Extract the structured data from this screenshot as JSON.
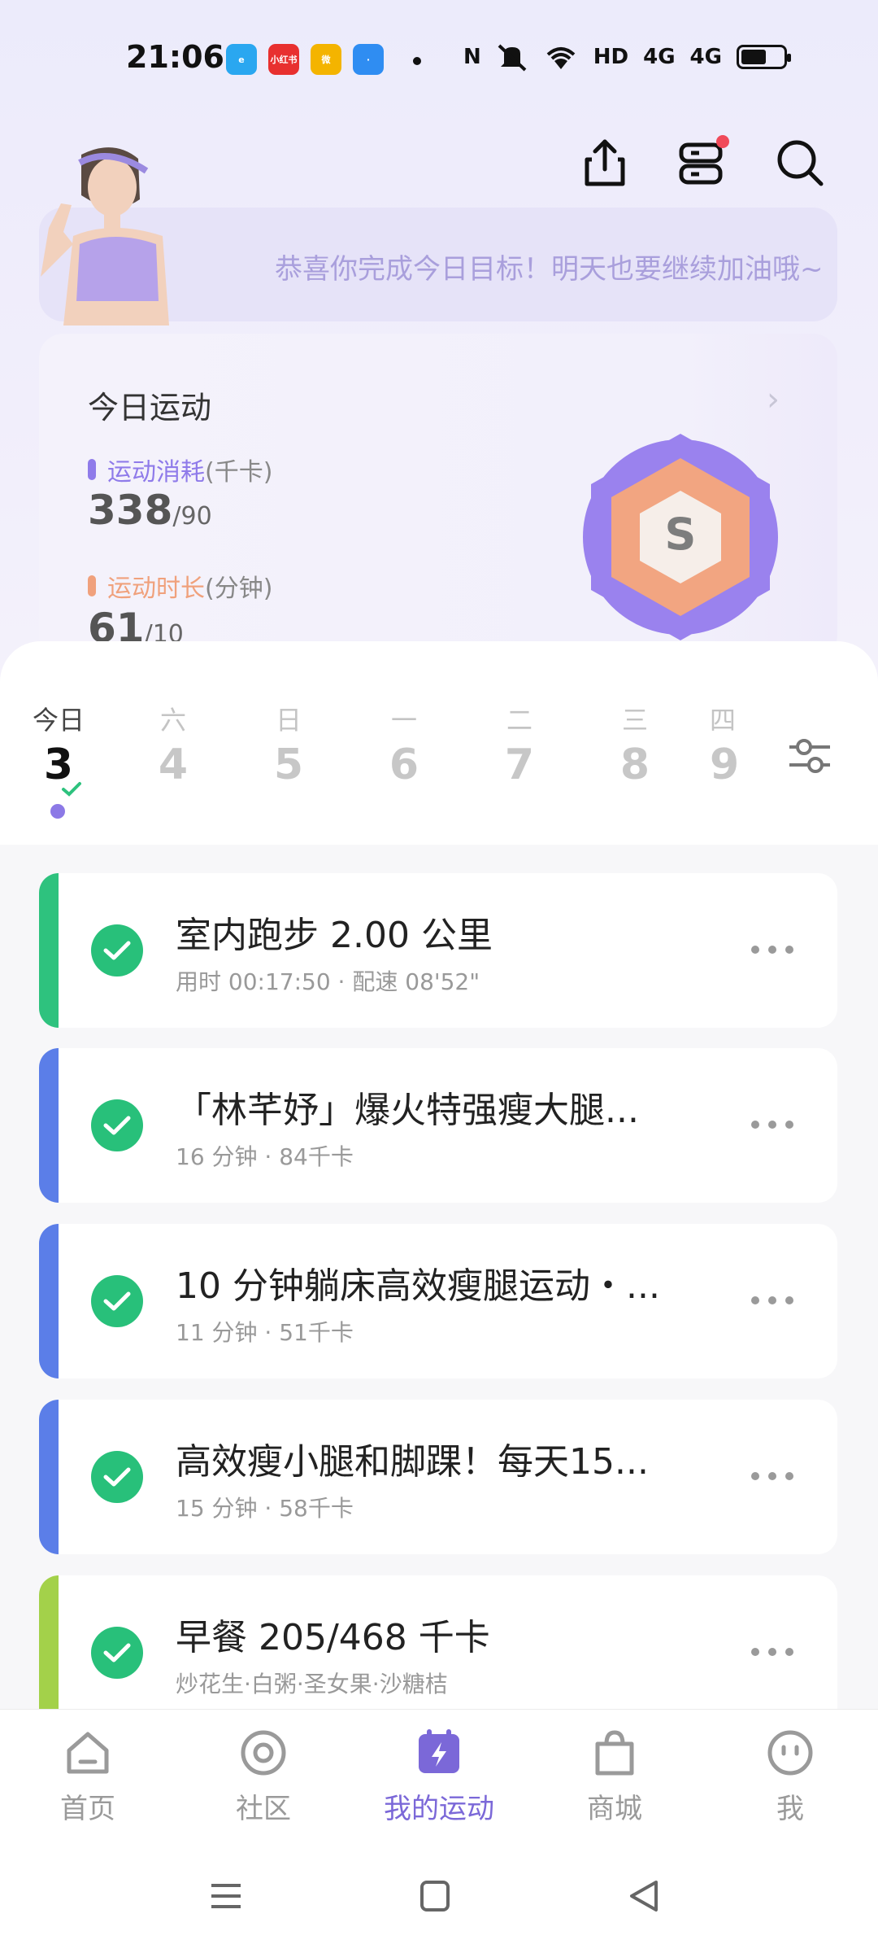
{
  "status_bar": {
    "time": "21:06",
    "notif_labels": [
      "e",
      "小红书",
      "微",
      "·"
    ],
    "net_labels": [
      "N",
      "HD",
      "4G",
      "4G"
    ]
  },
  "header": {
    "share_icon": "share-icon",
    "devices_icon": "devices-icon",
    "search_icon": "search-icon"
  },
  "banner": {
    "message": "恭喜你完成今日目标！明天也要继续加油哦~"
  },
  "today": {
    "title": "今日运动",
    "calories_label": "运动消耗",
    "calories_unit": "(千卡)",
    "calories_value": "338",
    "calories_goal": "/90",
    "duration_label": "运动时长",
    "duration_unit": "(分钟)",
    "duration_value": "61",
    "duration_goal": "/10",
    "ring_letter": "S",
    "colors": {
      "calories": "#8f7bea",
      "duration": "#f0a17c"
    }
  },
  "week": {
    "days": [
      {
        "weekday": "今日",
        "date": "3"
      },
      {
        "weekday": "六",
        "date": "4"
      },
      {
        "weekday": "日",
        "date": "5"
      },
      {
        "weekday": "一",
        "date": "6"
      },
      {
        "weekday": "二",
        "date": "7"
      },
      {
        "weekday": "三",
        "date": "8"
      },
      {
        "weekday": "四",
        "date": "9"
      }
    ]
  },
  "activities": [
    {
      "title": "室内跑步 2.00 公里",
      "sub": "用时 00:17:50 · 配速 08'52\"",
      "accent": "#2ec27e"
    },
    {
      "title": "「林芊妤」爆火特强瘦大腿...",
      "sub": "16 分钟 · 84千卡",
      "accent": "#5b7ee8"
    },
    {
      "title": "10 分钟躺床高效瘦腿运动・...",
      "sub": "11 分钟 · 51千卡",
      "accent": "#5b7ee8"
    },
    {
      "title": "高效瘦小腿和脚踝！每天15...",
      "sub": "15 分钟 · 58千卡",
      "accent": "#5b7ee8"
    },
    {
      "title": "早餐 205/468 千卡",
      "sub": "炒花生·白粥·圣女果·沙糖桔",
      "accent": "#a3d14a"
    }
  ],
  "bottom_nav": {
    "items": [
      {
        "label": "首页",
        "icon": "home-icon"
      },
      {
        "label": "社区",
        "icon": "community-icon"
      },
      {
        "label": "我的运动",
        "icon": "my-sport-icon"
      },
      {
        "label": "商城",
        "icon": "shop-icon"
      },
      {
        "label": "我",
        "icon": "profile-icon"
      }
    ],
    "active_color": "#7b68d8"
  }
}
